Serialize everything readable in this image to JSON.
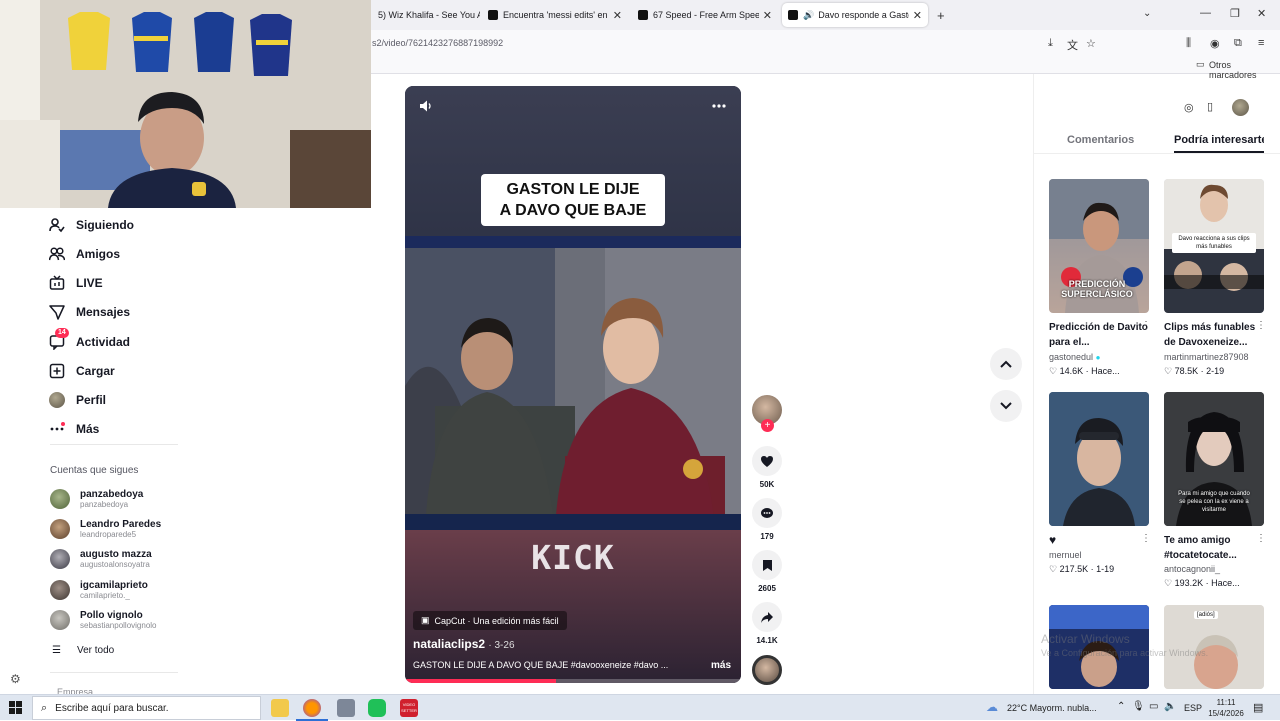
{
  "browser": {
    "tabs": [
      {
        "label": "5) Wiz Khalifa - See You A",
        "active": false
      },
      {
        "label": "Encuentra 'messi edits' en TikTo",
        "active": false
      },
      {
        "label": "67 Speed - Free Arm Speed Ch",
        "active": false
      },
      {
        "label": "Davo responde a Gaston E",
        "active": true
      }
    ],
    "url": "s2/video/7621423276887198992",
    "bookmarks_label": "Otros marcadores"
  },
  "sidebar": {
    "nav": [
      {
        "label": "Siguiendo",
        "icon": "following-icon"
      },
      {
        "label": "Amigos",
        "icon": "friends-icon"
      },
      {
        "label": "LIVE",
        "icon": "live-icon"
      },
      {
        "label": "Mensajes",
        "icon": "messages-icon"
      },
      {
        "label": "Actividad",
        "icon": "activity-icon",
        "badge": "14"
      },
      {
        "label": "Cargar",
        "icon": "upload-icon"
      },
      {
        "label": "Perfil",
        "icon": "profile-avatar"
      },
      {
        "label": "Más",
        "icon": "more-icon"
      }
    ],
    "following_header": "Cuentas que sigues",
    "following": [
      {
        "name": "panzabedoya",
        "user": "panzabedoya"
      },
      {
        "name": "Leandro Paredes",
        "user": "leandroparede5"
      },
      {
        "name": "augusto mazza",
        "user": "augustoalonsoyatra"
      },
      {
        "name": "igcamilaprieto",
        "user": "camilaprieto._"
      },
      {
        "name": "Pollo vignolo",
        "user": "sebastianpollovignolo"
      }
    ],
    "see_all": "Ver todo",
    "footer_cut": "Empresa"
  },
  "video": {
    "title_line1": "GASTON LE DIJE",
    "title_line2": "A DAVO QUE BAJE",
    "kick_text": "KICK",
    "capcut": "CapCut · Una edición más fácil",
    "author": "nataliaclips2",
    "date": "3-26",
    "caption": "GASTON LE DIJE A DAVO QUE BAJE #davooxeneize #davo ...",
    "more": "más",
    "progress": 0.45
  },
  "actions": {
    "likes": "50K",
    "comments": "179",
    "saves": "2605",
    "shares": "14.1K"
  },
  "right_panel": {
    "tab_comments": "Comentarios",
    "tab_suggested": "Podría interesarte",
    "items": [
      {
        "title": "Predicción de Davito para el...",
        "author": "gastonedul",
        "verified": true,
        "likes": "14.6K",
        "date": "Hace...",
        "thumb_text": "PREDICCIÓN SUPERCLÁSICO"
      },
      {
        "title": "Clips más funables de Davoxeneize...",
        "author": "martinmartinez87908",
        "likes": "78.5K",
        "date": "2-19",
        "thumb_text": "Davo reacciona a sus clips más funables"
      },
      {
        "title": "",
        "author": "mernuel",
        "likes": "217.5K",
        "date": "1-19",
        "thumb_text": ""
      },
      {
        "title": "Te amo amigo #tocatetocate...",
        "author": "antocagnonii_",
        "likes": "193.2K",
        "date": "Hace...",
        "thumb_text": "Para mi amigo que cuando se pelea con la ex viene a visitarme"
      }
    ],
    "bottom_thumb_text": "[adiós]"
  },
  "watermark": {
    "line1": "Activar Windows",
    "line2": "Ve a Configuración para activar Windows."
  },
  "taskbar": {
    "search_placeholder": "Escribe aquí para buscar.",
    "weather": "22°C  Mayorm. nubla...",
    "lang": "ESP",
    "time": "11:11",
    "date": "15/4/2026",
    "app_label": "VIDEO SETTER"
  }
}
